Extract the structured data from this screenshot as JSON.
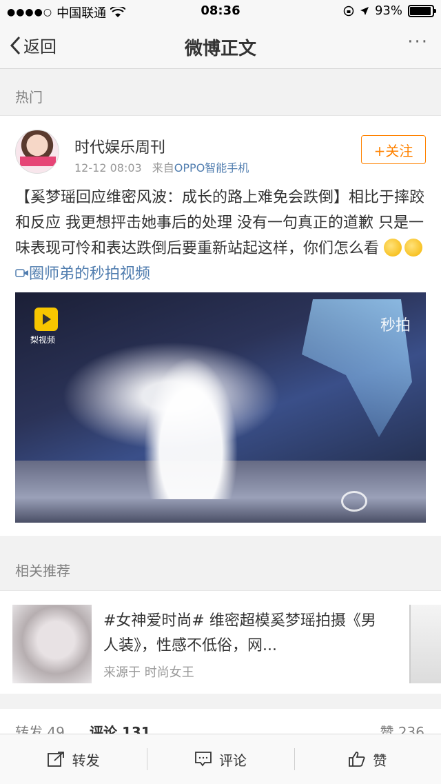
{
  "status_bar": {
    "carrier": "中国联通",
    "time": "08:36",
    "battery_text": "93%",
    "battery_level": 0.93
  },
  "nav": {
    "back_label": "返回",
    "title": "微博正文",
    "more_label": "···"
  },
  "hot_label": "热门",
  "post": {
    "author": "时代娱乐周刊",
    "time": "12-12 08:03",
    "source_prefix": "来自",
    "source": "OPPO智能手机",
    "follow_label": "+关注",
    "text": "【奚梦瑶回应维密风波：成长的路上难免会跌倒】相比于摔跤和反应 我更想抨击她事后的处理 没有一句真正的道歉 只是一味表现可怜和表达跌倒后要重新站起这样，你们怎么看",
    "video_link": "圈师弟的秒拍视频",
    "video_logo_text": "梨视频",
    "video_watermark": "秒拍"
  },
  "recommend": {
    "label": "相关推荐",
    "title": "#女神爱时尚# 维密超模奚梦瑶拍摄《男人装》，性感不低俗，网...",
    "source": "来源于 时尚女王"
  },
  "stats": {
    "forward": "转发 49",
    "comments": "评论 131",
    "likes": "赞 236"
  },
  "toolbar": {
    "forward": "转发",
    "comment": "评论",
    "like": "赞"
  }
}
